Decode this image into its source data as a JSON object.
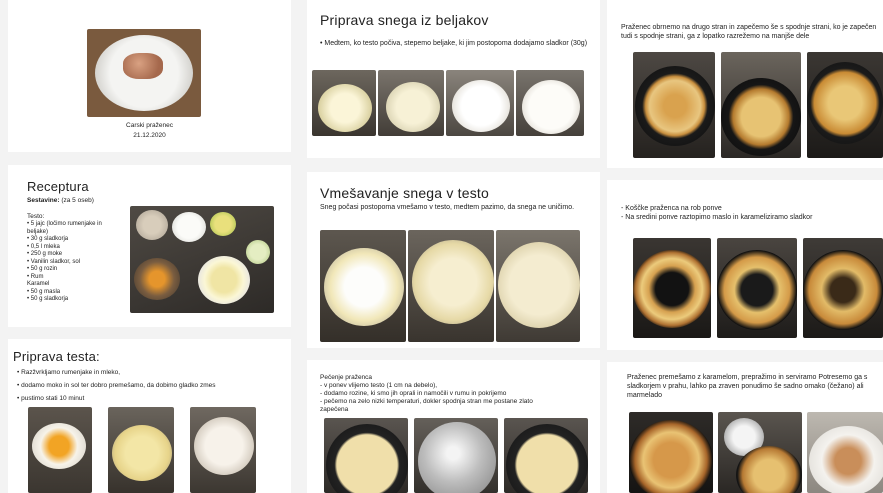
{
  "col1": {
    "cover": {
      "caption": "Carski praženec",
      "date": "21.12.2020"
    },
    "recipe": {
      "title": "Receptura",
      "servings_label": "Sestavine:",
      "servings_value": "(za 5 oseb)",
      "dough_label": "Testo:",
      "dough_items": [
        "5 jajc (ločimo rumenjake in beljake)",
        "30 g sladkorja",
        "0,5 l mleka",
        "250 g moke",
        "Vanilin sladkor, sol",
        "50 g  rozin",
        "Rum"
      ],
      "caramel_label": "Karamel",
      "caramel_items": [
        "50 g masla",
        "50 g sladkorja"
      ]
    },
    "dough": {
      "title": "Priprava testa:",
      "steps": [
        "Razžvrkljamo rumenjake in mleko,",
        "dodamo moko in sol ter dobro premešamo, da dobimo gladko zmes",
        "pustimo stati 10 minut"
      ]
    }
  },
  "col2": {
    "whites": {
      "title": "Priprava snega iz beljakov",
      "text": "Medtem, ko testo počiva, stepemo beljake, ki jim postopoma dodajamo sladkor (30g)"
    },
    "mix": {
      "title": "Vmešavanje snega v testo",
      "text": "Sneg počasi postopoma vmešamo v testo, medtem pazimo, da snega ne uničimo."
    },
    "bake": {
      "title": "Pečenje praženca",
      "lines": [
        "- v ponev vlijemo testo (1 cm na debelo),",
        "- dodamo rozine, ki smo jih oprali in namočili v rumu in pokrijemo",
        "- pečemo na zelo nizki temperaturi, dokler spodnja stran me postane zlato",
        "zapečena"
      ]
    }
  },
  "col3": {
    "flip": {
      "text": "Praženec obrnemo na drugo stran in zapečemo še s spodnje strani, ko je zapečen tudi s spodnje strani, ga z lopatko razrežemo na manjše dele"
    },
    "caramel": {
      "lines": [
        "- Koščke praženca na rob ponve",
        "- Na sredini ponve raztopimo maslo in karameliziramo sladkor"
      ]
    },
    "serve": {
      "text": "Praženec premešamo z karamelom, prepražimo in serviramo Potresemo ga s sladkorjem v prahu, lahko pa zraven ponudimo še sadno omako (čežano) ali marmelado"
    }
  }
}
